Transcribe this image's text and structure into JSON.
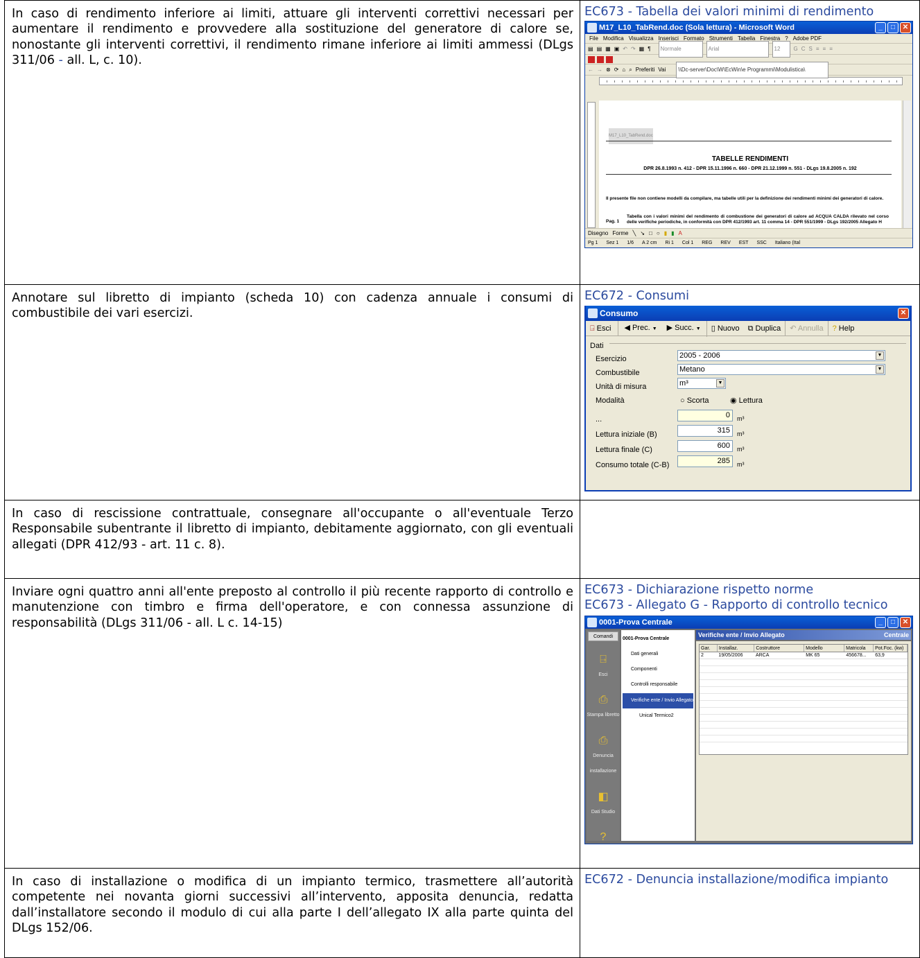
{
  "rows": [
    {
      "text_before": "In caso di rendimento inferiore ai limiti, attuare gli interventi correttivi necessari per aumentare il rendimento e provvedere alla sostituzione del generatore di calore se, nonostante gli interventi correttivi, il rendimento rimane inferiore ai limiti ammessi (DLgs 311/06 ",
      "text_dash": "-",
      "text_after": " all. L, c. 10).",
      "links": [
        "EC673 - Tabella dei valori minimi di rendimento"
      ]
    },
    {
      "text": "Annotare sul libretto di impianto (scheda 10) con cadenza annuale i consumi di combustibile dei vari esercizi.",
      "links": [
        "EC672 - Consumi"
      ]
    },
    {
      "text": "In caso di rescissione contrattuale, consegnare all'occupante o all'eventuale Terzo Responsabile subentrante il libretto di impianto, debitamente aggiornato, con gli eventuali allegati (DPR 412/93 - art. 11 c. 8).",
      "links": []
    },
    {
      "text": "Inviare ogni quattro anni all'ente preposto al controllo il più recente rapporto di controllo e manutenzione con timbro e firma dell'operatore, e con connessa assunzione di responsabilità (DLgs 311/06 - all. L c. 14-15)",
      "links": [
        "EC673 - Dichiarazione rispetto norme",
        "EC673 - Allegato G - Rapporto di controllo tecnico"
      ]
    },
    {
      "text": "In caso di installazione o modifica di un impianto termico, trasmettere all’autorità competente nei novanta giorni successivi all’intervento, apposita denuncia, redatta dall’installatore secondo il modulo di cui alla parte I dell’allegato IX alla parte quinta del DLgs 152/06.",
      "links": [
        "EC672 - Denuncia installazione/modifica impianto"
      ]
    }
  ],
  "word_window": {
    "title": "M17_L10_TabRend.doc (Sola lettura) - Microsoft Word",
    "menu": [
      "File",
      "Modifica",
      "Visualizza",
      "Inserisci",
      "Formato",
      "Strumenti",
      "Tabella",
      "Finestra",
      "?",
      "Adobe PDF"
    ],
    "style_box": "Normale",
    "font_box": "Arial",
    "size_box": "12",
    "address": "\\\\Dc-server\\Doc\\W\\EcWin\\e Programmi\\Modulistica\\",
    "preferiti": "Preferiti",
    "vai": "Vai",
    "header_text": "M17_L10_TabRend.doc",
    "doc_title": "TABELLE RENDIMENTI",
    "doc_subtitle": "DPR 26.8.1993 n. 412 - DPR 15.11.1996 n. 660 - DPR 21.12.1999 n. 551 - DLgs 19.8.2005 n. 192",
    "doc_para": "Il presente file non contiene modelli da compilare, ma tabelle utili per la definizione dei rendimenti minimi dei generatori di calore.",
    "pag_label": "Pag. 1",
    "pag_text": "Tabella con i valori minimi del rendimento di combustione dei generatori di calore ad ACQUA CALDA rilevato nel corso delle verifiche periodiche, in conformità con DPR 412/1993 art. 11 comma 14 - DPR 551/1999 - DLgs 192/2005 Allegato H",
    "draw_label": "Disegno",
    "forme_label": "Forme",
    "status": [
      "Pg 1",
      "Sez 1",
      "1/6",
      "A 2 cm",
      "Ri 1",
      "Col 1",
      "REG",
      "REV",
      "EST",
      "SSC",
      "Italiano (Ital"
    ]
  },
  "consumo_dialog": {
    "title": "Consumo",
    "toolbar": [
      "Esci",
      "Prec.",
      "Succ.",
      "Nuovo",
      "Duplica",
      "Annulla",
      "Help"
    ],
    "group_label": "Dati",
    "fields": [
      {
        "label": "Esercizio",
        "value": "2005 - 2006",
        "type": "combo"
      },
      {
        "label": "Combustibile",
        "value": "Metano",
        "type": "combo"
      },
      {
        "label": "Unità di misura",
        "value": "m³",
        "type": "combo-small"
      }
    ],
    "modalita_label": "Modalità",
    "radio_options": [
      "Scorta",
      "Lettura"
    ],
    "radio_selected": "Lettura",
    "numeric_fields": [
      {
        "label": "...",
        "value": "0",
        "unit": "m³",
        "highlight": true
      },
      {
        "label": "Lettura iniziale (B)",
        "value": "315",
        "unit": "m³",
        "highlight": false
      },
      {
        "label": "Lettura finale (C)",
        "value": "600",
        "unit": "m³",
        "highlight": false
      },
      {
        "label": "Consumo totale (C-B)",
        "value": "285",
        "unit": "m³",
        "highlight": true
      }
    ]
  },
  "centrale_window": {
    "title": "0001-Prova Centrale",
    "commands_header": "Comandi",
    "commands": [
      "Esci",
      "Stampa libretto",
      "Denuncia installazione",
      "Dati Studio",
      "Help"
    ],
    "tree": [
      "0001-Prova Centrale",
      "Dati generali",
      "Componenti",
      "Controlli responsabile",
      "Verifiche ente / Invio Allegato",
      "Unical Termico2"
    ],
    "panel_title": "Verifiche ente / Invio Allegato",
    "panel_right": "Centrale",
    "columns": [
      "Gar.",
      "Installaz.",
      "Costruttore",
      "Modello",
      "Matricola",
      "Pot.Foc. (kw)"
    ],
    "row": [
      "2",
      "19/05/2006",
      "ARCA",
      "MK 65",
      "456678...",
      "63,9"
    ]
  }
}
